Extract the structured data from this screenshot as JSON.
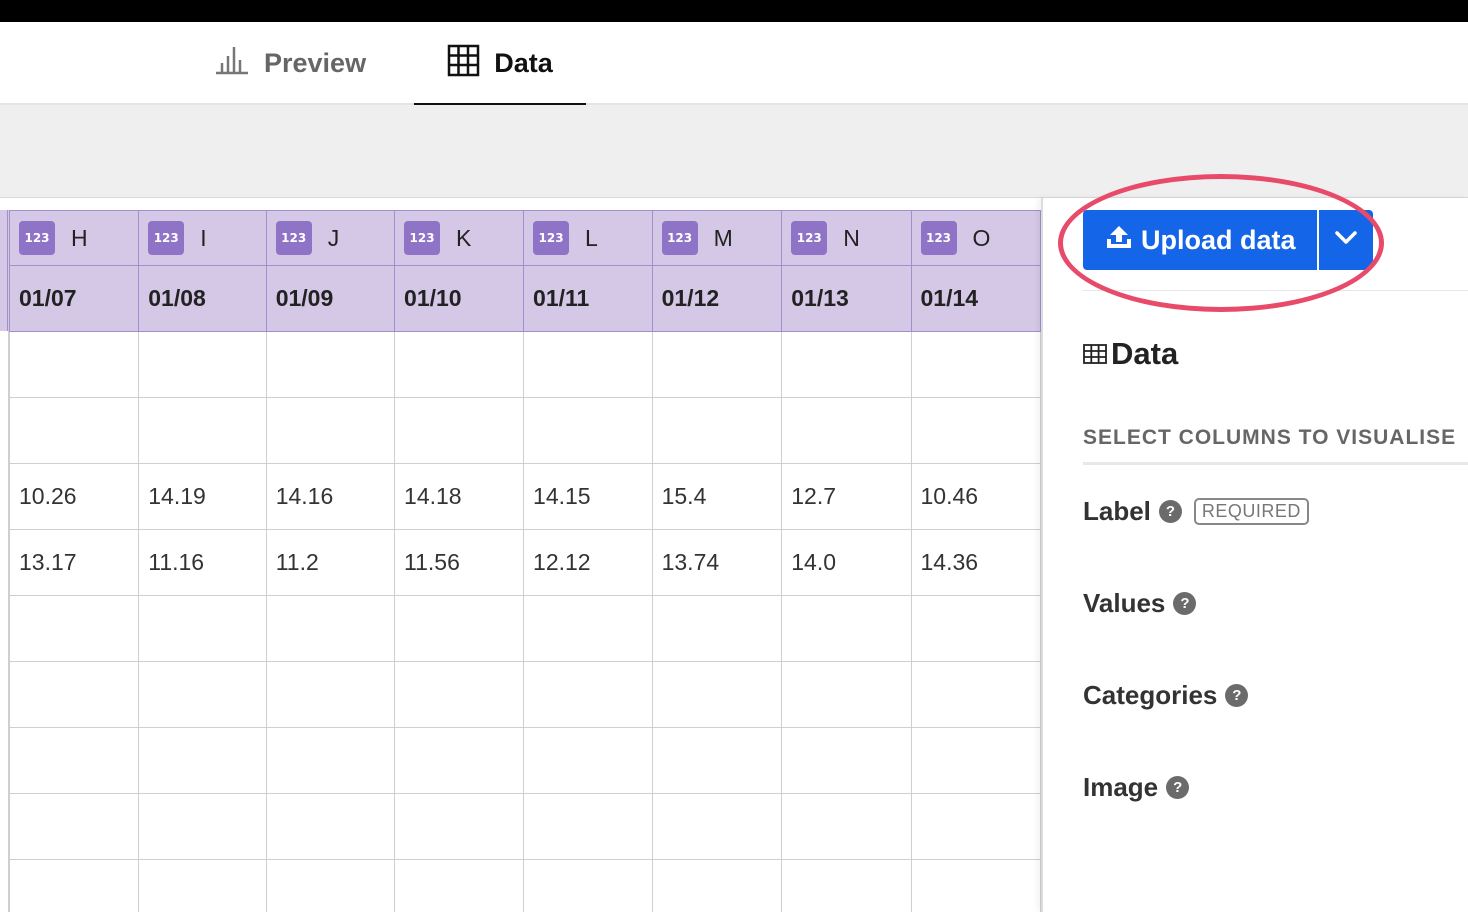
{
  "tabs": {
    "preview_label": "Preview",
    "data_label": "Data"
  },
  "grid": {
    "columns": [
      {
        "letter": "H",
        "type": "123",
        "date": "01/07"
      },
      {
        "letter": "I",
        "type": "123",
        "date": "01/08"
      },
      {
        "letter": "J",
        "type": "123",
        "date": "01/09"
      },
      {
        "letter": "K",
        "type": "123",
        "date": "01/10"
      },
      {
        "letter": "L",
        "type": "123",
        "date": "01/11"
      },
      {
        "letter": "M",
        "type": "123",
        "date": "01/12"
      },
      {
        "letter": "N",
        "type": "123",
        "date": "01/13"
      },
      {
        "letter": "O",
        "type": "123",
        "date": "01/14"
      }
    ],
    "rows": [
      [
        "",
        "",
        "",
        "",
        "",
        "",
        "",
        ""
      ],
      [
        "",
        "",
        "",
        "",
        "",
        "",
        "",
        ""
      ],
      [
        "10.26",
        "14.19",
        "14.16",
        "14.18",
        "14.15",
        "15.4",
        "12.7",
        "10.46"
      ],
      [
        "13.17",
        "11.16",
        "11.2",
        "11.56",
        "12.12",
        "13.74",
        "14.0",
        "14.36"
      ],
      [
        "",
        "",
        "",
        "",
        "",
        "",
        "",
        ""
      ],
      [
        "",
        "",
        "",
        "",
        "",
        "",
        "",
        ""
      ],
      [
        "",
        "",
        "",
        "",
        "",
        "",
        "",
        ""
      ],
      [
        "",
        "",
        "",
        "",
        "",
        "",
        "",
        ""
      ],
      [
        "",
        "",
        "",
        "",
        "",
        "",
        "",
        ""
      ]
    ]
  },
  "panel": {
    "upload_label": "Upload data",
    "title": "Data",
    "subhead": "SELECT COLUMNS TO VISUALISE",
    "fields": [
      {
        "label": "Label",
        "badge": "REQUIRED"
      },
      {
        "label": "Values"
      },
      {
        "label": "Categories"
      },
      {
        "label": "Image"
      }
    ]
  },
  "colors": {
    "accent": "#1565e8",
    "header_bg": "#d4c8e6",
    "type_badge": "#8f73c6",
    "highlight": "#e84a6a"
  }
}
